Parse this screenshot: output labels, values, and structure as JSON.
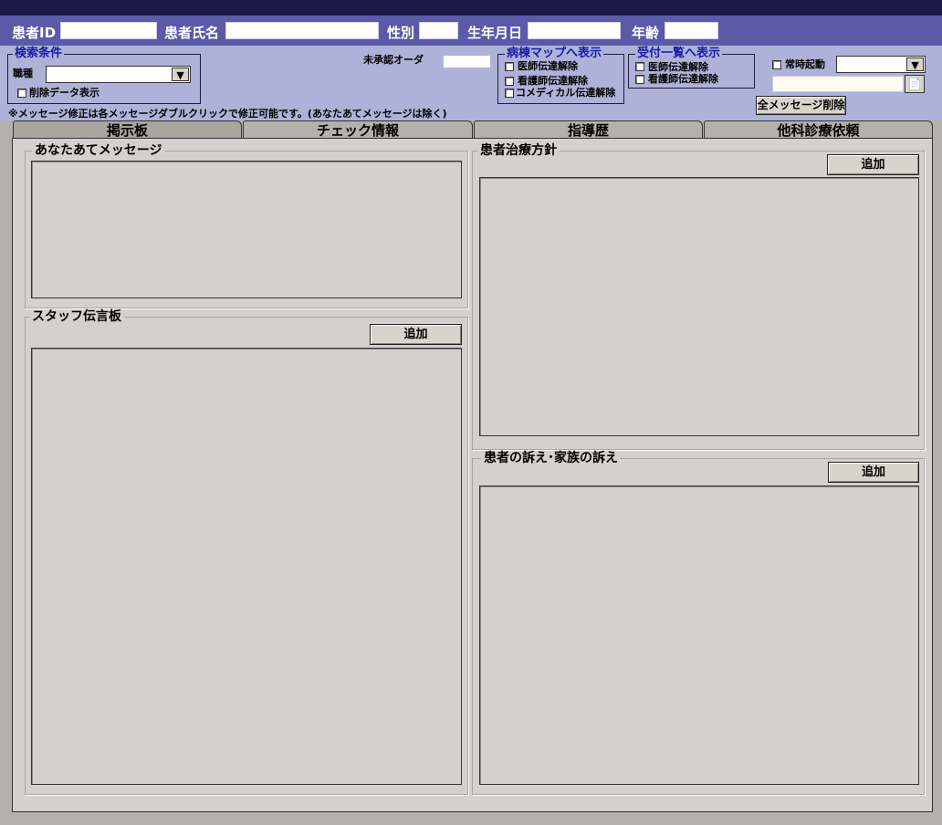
{
  "patient": {
    "id_label": "患者ID",
    "name_label": "患者氏名",
    "sex_label": "性別",
    "dob_label": "生年月日",
    "age_label": "年齢",
    "id_value": "",
    "name_value": "",
    "sex_value": "",
    "dob_value": "",
    "age_value": ""
  },
  "search": {
    "title": "検索条件",
    "job_label": "職種",
    "job_value": "",
    "show_deleted_label": "削除データ表示"
  },
  "unapproved_order_label": "未承認オーダ",
  "unapproved_order_value": "",
  "ward_map": {
    "title": "病棟マップへ表示",
    "items": [
      "医師伝達解除",
      "看護師伝達解除",
      "コメディカル伝達解除"
    ]
  },
  "reception": {
    "title": "受付一覧へ表示",
    "items": [
      "医師伝達解除",
      "看護師伝達解除"
    ]
  },
  "auto_start_label": "常時起動",
  "auto_start_value": "",
  "note_text": "",
  "delete_all_label": "全メッセージ削除",
  "notice": "※メッセージ修正は各メッセージダブルクリックで修正可能です。(あなたあてメッセージは除く)",
  "tabs": [
    "掲示板",
    "チェック情報",
    "指導歴",
    "他科診療依頼"
  ],
  "board": {
    "to_you_title": "あなたあてメッセージ",
    "staff_board_title": "スタッフ伝言板",
    "treatment_policy_title": "患者治療方針",
    "complaints_title": "患者の訴え･家族の訴え",
    "add_label": "追加"
  },
  "colors": {
    "title_bar": "#1b1b4a",
    "patient_bar": "#5a5aa8",
    "filter_bar": "#aeb2d8",
    "group_title": "#1a1aa8",
    "panel": "#d4d0cc"
  }
}
